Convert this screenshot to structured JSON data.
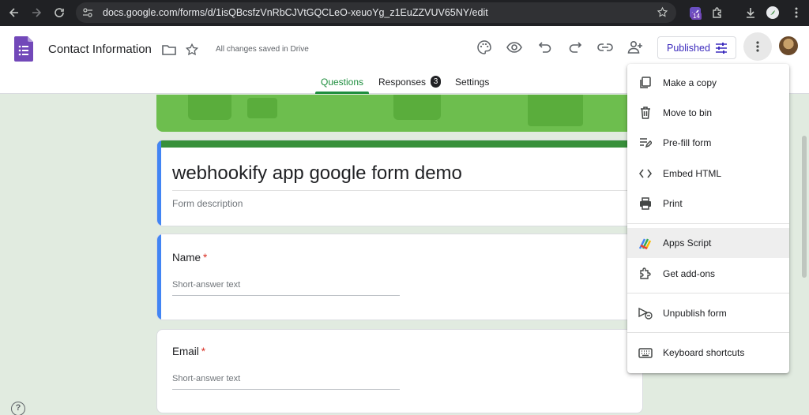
{
  "browser": {
    "url": "docs.google.com/forms/d/1isQBcsfzVnRbCJVtGQCLeO-xeuoYg_z1EuZZVUV65NY/edit",
    "extension_badge": "14"
  },
  "header": {
    "doc_title": "Contact Information",
    "save_status": "All changes saved in Drive",
    "publish_label": "Published"
  },
  "tabs": [
    {
      "label": "Questions"
    },
    {
      "label": "Responses",
      "badge": "3"
    },
    {
      "label": "Settings"
    }
  ],
  "form": {
    "title": "webhookify app google form demo",
    "description_placeholder": "Form description",
    "questions": [
      {
        "label": "Name",
        "required": "*",
        "hint": "Short-answer text"
      },
      {
        "label": "Email",
        "required": "*",
        "hint": "Short-answer text"
      }
    ]
  },
  "menu": {
    "items": [
      {
        "label": "Make a copy",
        "icon": "copy-icon"
      },
      {
        "label": "Move to bin",
        "icon": "trash-icon"
      },
      {
        "label": "Pre-fill form",
        "icon": "prefill-icon"
      },
      {
        "label": "Embed HTML",
        "icon": "code-icon"
      },
      {
        "label": "Print",
        "icon": "print-icon"
      },
      {
        "label": "Apps Script",
        "icon": "apps-script-icon"
      },
      {
        "label": "Get add-ons",
        "icon": "puzzle-icon"
      },
      {
        "label": "Unpublish form",
        "icon": "unpublish-icon"
      },
      {
        "label": "Keyboard shortcuts",
        "icon": "keyboard-icon"
      }
    ]
  },
  "help_glyph": "?",
  "colors": {
    "theme_green": "#38903a",
    "banner_green": "#6dbe4e",
    "accent_blue": "#4285f4",
    "publish_purple": "#3c2bbd",
    "required_red": "#d93025",
    "background": "#e1ebe0"
  }
}
